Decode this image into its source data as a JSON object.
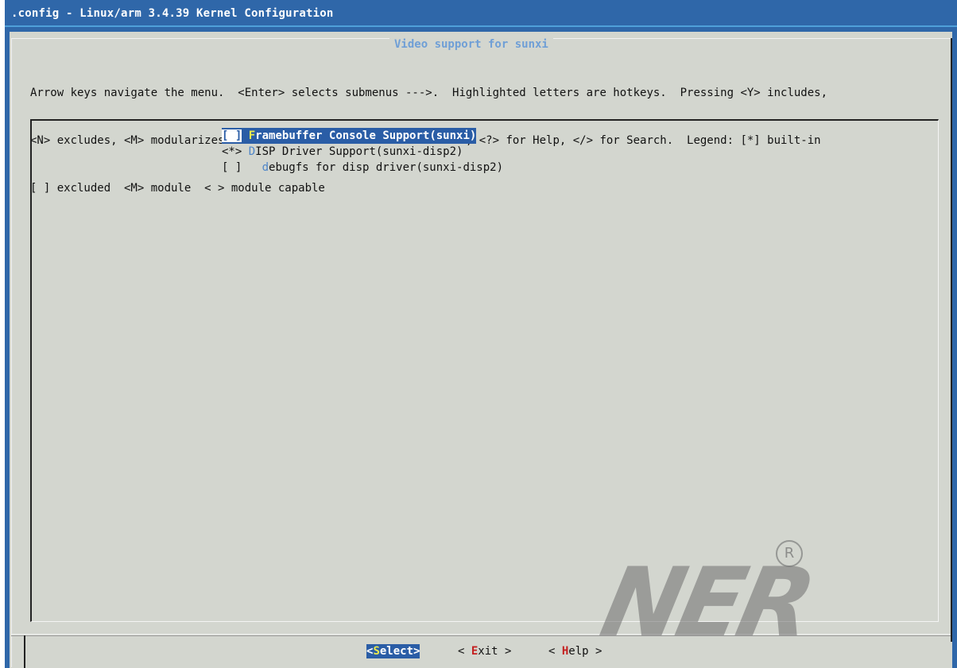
{
  "window": {
    "title": ".config - Linux/arm 3.4.39 Kernel Configuration"
  },
  "dialog": {
    "title": "Video support for sunxi",
    "help_lines": [
      "Arrow keys navigate the menu.  <Enter> selects submenus --->.  Highlighted letters are hotkeys.  Pressing <Y> includes,",
      "<N> excludes, <M> modularizes features.  Press <Esc><Esc> to exit, <?> for Help, </> for Search.  Legend: [*] built-in",
      "[ ] excluded  <M> module  < > module capable"
    ]
  },
  "menu": {
    "items": [
      {
        "prefix": "[ ]",
        "hotkey": "F",
        "rest": "ramebuffer Console Support(sunxi)",
        "selected": true
      },
      {
        "prefix": "<*>",
        "hotkey": "D",
        "rest": "ISP Driver Support(sunxi-disp2)",
        "selected": false
      },
      {
        "prefix": "[ ]   ",
        "hotkey": "d",
        "rest": "ebugfs for disp driver(sunxi-disp2)",
        "selected": false
      }
    ]
  },
  "buttons": {
    "select": {
      "open": "<",
      "hotkey": "S",
      "rest": "elect>"
    },
    "exit": {
      "open": "< ",
      "hotkey": "E",
      "rest": "xit >"
    },
    "help": {
      "open": "< ",
      "hotkey": "H",
      "rest": "elp >"
    }
  },
  "watermark": {
    "text": "NER",
    "mark": "R"
  },
  "colors": {
    "terminal_bg": "#2f67a9",
    "dialog_bg": "#d3d6cf",
    "highlight": "#2a5da6",
    "hotkey_blue": "#4f86c8",
    "hotkey_yellow": "#e9e94f",
    "hotkey_red": "#c42020"
  }
}
